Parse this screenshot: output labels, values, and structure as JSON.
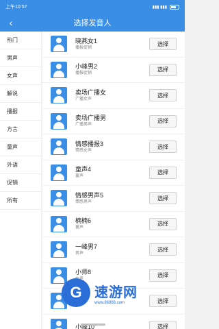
{
  "status_bar": {
    "time": "上午10:57",
    "signal_text": "▮▮▮ ▮▮▮"
  },
  "header": {
    "title": "选择发音人"
  },
  "sidebar": {
    "items": [
      {
        "label": "热门"
      },
      {
        "label": "男声"
      },
      {
        "label": "女声"
      },
      {
        "label": "解说"
      },
      {
        "label": "播报"
      },
      {
        "label": "方言"
      },
      {
        "label": "童声"
      },
      {
        "label": "外语"
      },
      {
        "label": "促销"
      },
      {
        "label": "所有"
      }
    ]
  },
  "voices": [
    {
      "name": "晓燕女1",
      "desc": "播报促销",
      "button": "选择"
    },
    {
      "name": "小峰男2",
      "desc": "播报促销",
      "button": "选择"
    },
    {
      "name": "卖场广播女",
      "desc": "广播女声",
      "button": "选择"
    },
    {
      "name": "卖场广播男",
      "desc": "广播男声",
      "button": "选择"
    },
    {
      "name": "情感播报3",
      "desc": "情感女声",
      "button": "选择"
    },
    {
      "name": "童声4",
      "desc": "童声",
      "button": "选择"
    },
    {
      "name": "情感男声5",
      "desc": "情感男声",
      "button": "选择"
    },
    {
      "name": "楠楠6",
      "desc": "童声",
      "button": "选择"
    },
    {
      "name": "一峰男7",
      "desc": "男声",
      "button": "选择"
    },
    {
      "name": "小师8",
      "desc": "女声",
      "button": "选择"
    },
    {
      "name": "",
      "desc": "",
      "button": "选择"
    },
    {
      "name": "小峰10",
      "desc": "",
      "button": "选择"
    }
  ],
  "watermark": {
    "brand": "速游网",
    "url": "www.86866.com",
    "logo_glyph": "G"
  },
  "colors": {
    "primary": "#3a8ee6",
    "watermark": "#2b6ed8"
  }
}
